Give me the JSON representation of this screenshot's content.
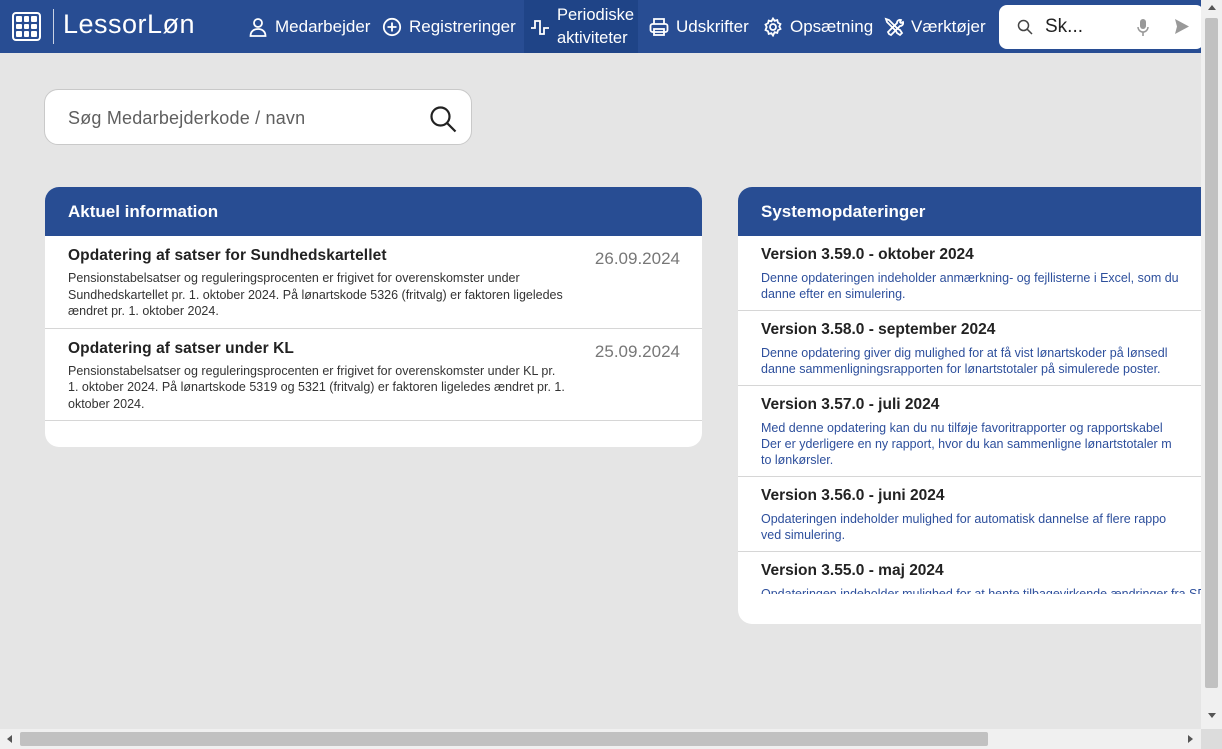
{
  "app": {
    "title": "LessorLøn"
  },
  "nav": [
    {
      "label": "Medarbejder",
      "icon": "person-icon"
    },
    {
      "label": "Registreringer",
      "icon": "plus-circle-icon"
    },
    {
      "label_line1": "Periodiske",
      "label_line2": "aktiviteter",
      "icon": "pulse-icon"
    },
    {
      "label": "Udskrifter",
      "icon": "printer-icon"
    },
    {
      "label": "Opsætning",
      "icon": "gear-icon"
    },
    {
      "label": "Værktøjer",
      "icon": "tools-icon"
    }
  ],
  "top_search": {
    "value": "Sk..."
  },
  "employee_search": {
    "placeholder": "Søg Medarbejderkode / navn"
  },
  "news": {
    "title": "Aktuel information",
    "items": [
      {
        "title": "Opdatering af satser for Sundhedskartellet",
        "date": "26.09.2024",
        "text": "Pensionstabelsatser og reguleringsprocenten er frigivet for overenskomster under Sundhedskartellet pr. 1. oktober 2024. På lønartskode 5326 (fritvalg) er faktoren ligeledes ændret pr. 1. oktober 2024."
      },
      {
        "title": "Opdatering af satser under KL",
        "date": "25.09.2024",
        "text": "Pensionstabelsatser og reguleringsprocenten er frigivet for overenskomster under KL pr. 1. oktober 2024. På lønartskode 5319 og 5321 (fritvalg) er faktoren ligeledes ændret pr. 1. oktober 2024."
      }
    ]
  },
  "updates": {
    "title": "Systemopdateringer",
    "items": [
      {
        "title": "Version 3.59.0 - oktober 2024",
        "line1": "Denne opdateringen indeholder anmærkning- og fejllisterne i Excel, som du",
        "line2": "danne efter en simulering."
      },
      {
        "title": "Version 3.58.0 - september 2024",
        "line1": "Denne opdatering giver dig mulighed for at få vist lønartskoder på lønsedl",
        "line2": "danne sammenligningsrapporten for lønartstotaler på simulerede poster."
      },
      {
        "title": "Version 3.57.0 - juli 2024",
        "line1": "Med denne opdatering kan du nu tilføje favoritrapporter og rapportskabel",
        "line2": "Der er yderligere en ny rapport, hvor du kan sammenligne lønartstotaler m",
        "line3": "to lønkørsler."
      },
      {
        "title": "Version 3.56.0 - juni 2024",
        "line1": "Opdateringen indeholder mulighed for automatisk dannelse af flere rappo",
        "line2": "ved simulering."
      },
      {
        "title": "Version 3.55.0 - maj 2024",
        "line1": "Opdateringen indeholder mulighed for at hente tilbagevirkende ændringer fra SD"
      }
    ]
  },
  "colors": {
    "brand": "#284d93",
    "link_text": "#2d4f9c",
    "background": "#e5e5e5"
  }
}
